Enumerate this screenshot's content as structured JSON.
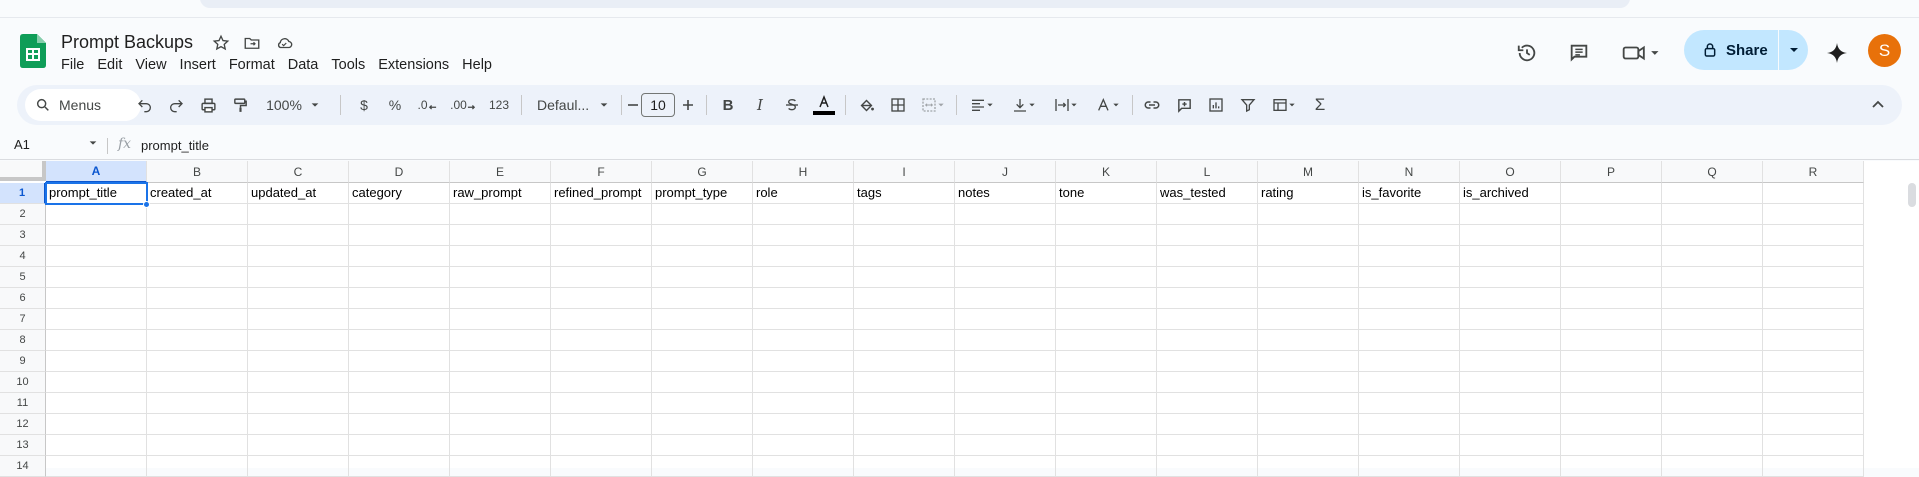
{
  "document": {
    "title": "Prompt Backups",
    "menus": [
      "File",
      "Edit",
      "View",
      "Insert",
      "Format",
      "Data",
      "Tools",
      "Extensions",
      "Help"
    ]
  },
  "header": {
    "share_label": "Share",
    "avatar_initial": "S"
  },
  "toolbar": {
    "search_label": "Menus",
    "zoom": "100%",
    "currency": "$",
    "percent": "%",
    "decrease_decimal": ".0",
    "increase_decimal": ".00",
    "number_format": "123",
    "font": "Defaul...",
    "font_size": "10",
    "bold": "B",
    "italic": "I"
  },
  "formula_bar": {
    "cell_ref": "A1",
    "fx": "fx",
    "value": "prompt_title"
  },
  "sheet": {
    "columns": [
      "A",
      "B",
      "C",
      "D",
      "E",
      "F",
      "G",
      "H",
      "I",
      "J",
      "K",
      "L",
      "M",
      "N",
      "O",
      "P",
      "Q",
      "R"
    ],
    "rows": [
      "1",
      "2",
      "3",
      "4",
      "5",
      "6",
      "7",
      "8",
      "9",
      "10",
      "11",
      "12",
      "13",
      "14"
    ],
    "row1": [
      "prompt_title",
      "created_at",
      "updated_at",
      "category",
      "raw_prompt",
      "refined_prompt",
      "prompt_type",
      "role",
      "tags",
      "notes",
      "tone",
      "was_tested",
      "rating",
      "is_favorite",
      "is_archived",
      "",
      "",
      ""
    ]
  },
  "colors": {
    "accent": "#0b57d0",
    "share_bg": "#c2e7ff",
    "avatar": "#e8710a",
    "sheets_green": "#0f9d58"
  }
}
